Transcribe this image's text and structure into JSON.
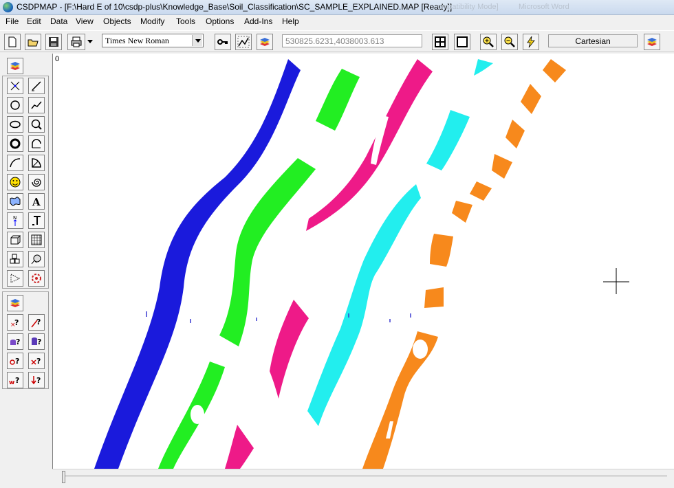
{
  "window": {
    "title": "CSDPMAP - [F:\\Hard E of 10\\csdp-plus\\Knowledge_Base\\Soil_Classification\\SC_SAMPLE_EXPLAINED.MAP [Ready]]",
    "ghost_left": "ompatibility Mode]",
    "ghost_right": "Microsoft Word"
  },
  "menu": [
    "File",
    "Edit",
    "Data",
    "View",
    "Objects",
    "Modify",
    "Tools",
    "Options",
    "Add-Ins",
    "Help"
  ],
  "toolbar": {
    "font_name": "Times New Roman",
    "coordinates": "530825.6231,4038003.613",
    "coordinate_system": "Cartesian"
  },
  "canvas": {
    "origin_label": "0",
    "colors": {
      "blue": "#1a1adc",
      "green": "#22ee22",
      "magenta": "#ee1a88",
      "cyan": "#22eeee",
      "orange": "#f7891c"
    }
  },
  "icons": {
    "top_toolbar": [
      "new-file-icon",
      "open-folder-icon",
      "save-icon",
      "print-icon",
      "key-icon",
      "path-tool-icon",
      "layers-icon",
      "grid-view-icon",
      "single-view-icon",
      "zoom-in-icon",
      "zoom-out-icon",
      "lightning-icon",
      "layers-icon"
    ],
    "sidebar_tools": [
      "point-icon",
      "line-icon",
      "circle-icon",
      "polyline-icon",
      "ellipse-icon",
      "circle-select-icon",
      "ring-icon",
      "arc-select-icon",
      "curve-icon",
      "pie-icon",
      "smiley-icon",
      "spiral-icon",
      "map-symbol-icon",
      "text-icon",
      "north-arrow-icon",
      "leader-icon",
      "box-3d-icon",
      "grid-icon",
      "cluster-icon",
      "image-icon",
      "dotted-shape-icon",
      "spray-icon"
    ],
    "sidebar_query": [
      "query-point-icon",
      "query-line-icon",
      "query-cylinder-icon",
      "query-database-icon",
      "query-circle-icon",
      "query-x-icon",
      "query-w-icon",
      "query-down-icon"
    ]
  }
}
